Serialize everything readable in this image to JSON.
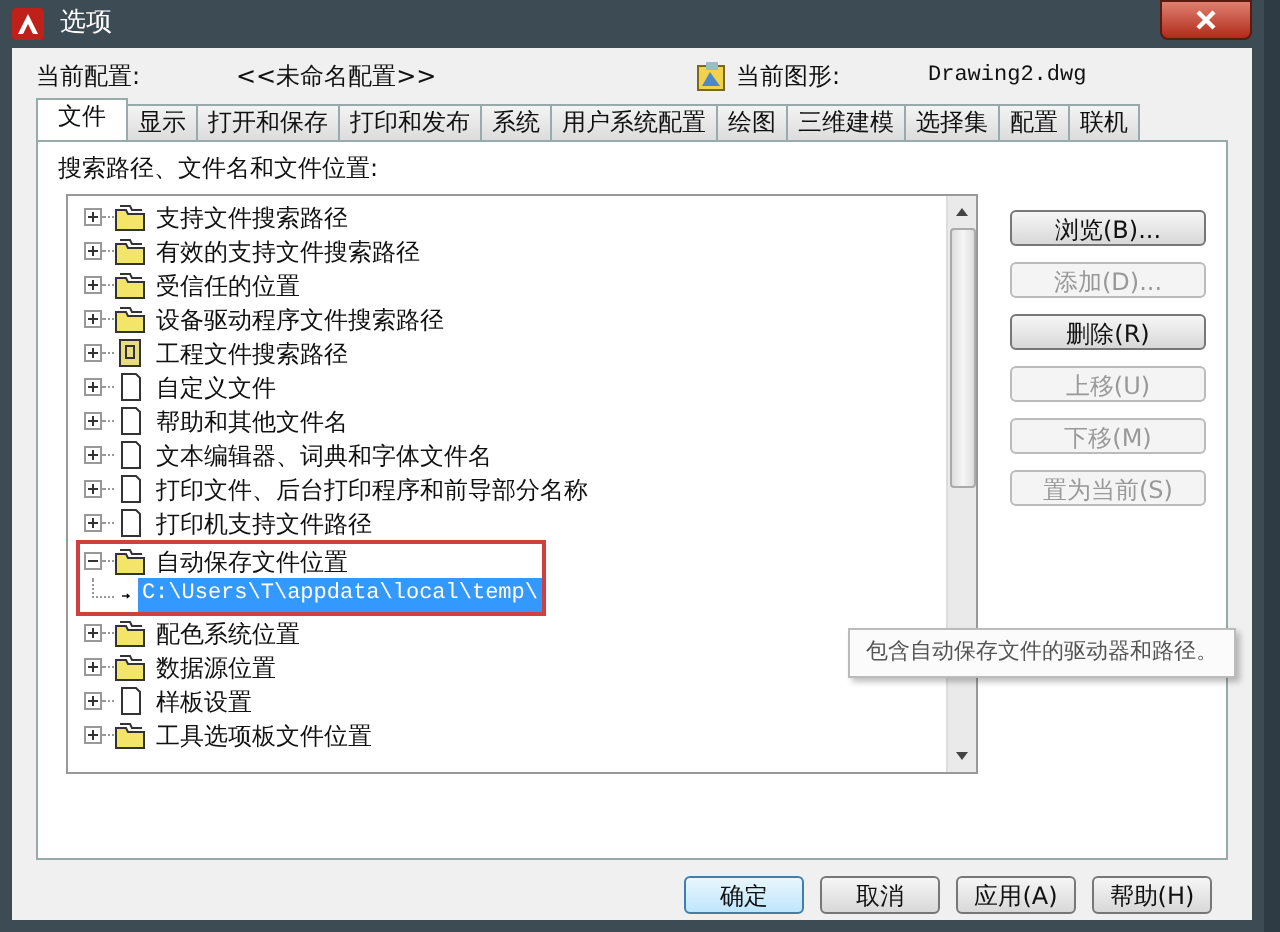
{
  "window": {
    "title": "选项"
  },
  "header": {
    "profile_label": "当前配置:",
    "profile": "<<未命名配置>>",
    "drawing_label": "当前图形:",
    "drawing": "Drawing2.dwg"
  },
  "tabs": [
    {
      "label": "文件",
      "selected": true
    },
    {
      "label": "显示",
      "selected": false
    },
    {
      "label": "打开和保存",
      "selected": false
    },
    {
      "label": "打印和发布",
      "selected": false
    },
    {
      "label": "系统",
      "selected": false
    },
    {
      "label": "用户系统配置",
      "selected": false
    },
    {
      "label": "绘图",
      "selected": false
    },
    {
      "label": "三维建模",
      "selected": false
    },
    {
      "label": "选择集",
      "selected": false
    },
    {
      "label": "配置",
      "selected": false
    },
    {
      "label": "联机",
      "selected": false
    }
  ],
  "panel": {
    "label": "搜索路径、文件名和文件位置:"
  },
  "tree": [
    {
      "label": "支持文件搜索路径",
      "kind": "folder",
      "expanded": false,
      "selected": false,
      "outlined": false
    },
    {
      "label": "有效的支持文件搜索路径",
      "kind": "folder",
      "expanded": false,
      "selected": false,
      "outlined": false
    },
    {
      "label": "受信任的位置",
      "kind": "folder",
      "expanded": false,
      "selected": false,
      "outlined": false
    },
    {
      "label": "设备驱动程序文件搜索路径",
      "kind": "folder",
      "expanded": false,
      "selected": false,
      "outlined": false
    },
    {
      "label": "工程文件搜索路径",
      "kind": "book",
      "expanded": false,
      "selected": false,
      "outlined": false
    },
    {
      "label": "自定义文件",
      "kind": "file",
      "expanded": false,
      "selected": false,
      "outlined": false
    },
    {
      "label": "帮助和其他文件名",
      "kind": "file",
      "expanded": false,
      "selected": false,
      "outlined": false
    },
    {
      "label": "文本编辑器、词典和字体文件名",
      "kind": "file",
      "expanded": false,
      "selected": false,
      "outlined": false
    },
    {
      "label": "打印文件、后台打印程序和前导部分名称",
      "kind": "file",
      "expanded": false,
      "selected": false,
      "outlined": false
    },
    {
      "label": "打印机支持文件路径",
      "kind": "file",
      "expanded": false,
      "selected": false,
      "outlined": false
    },
    {
      "label": "自动保存文件位置",
      "kind": "folder",
      "expanded": true,
      "selected": false,
      "outlined": true,
      "children": [
        {
          "label": "C:\\Users\\T\\appdata\\local\\temp\\",
          "selected": true
        }
      ]
    },
    {
      "label": "配色系统位置",
      "kind": "folder",
      "expanded": false,
      "selected": false,
      "outlined": false
    },
    {
      "label": "数据源位置",
      "kind": "folder",
      "expanded": false,
      "selected": false,
      "outlined": false
    },
    {
      "label": "样板设置",
      "kind": "file",
      "expanded": false,
      "selected": false,
      "outlined": false
    },
    {
      "label": "工具选项板文件位置",
      "kind": "folder",
      "expanded": false,
      "selected": false,
      "outlined": false
    }
  ],
  "side_buttons": [
    {
      "label": "浏览(B)...",
      "disabled": false
    },
    {
      "label": "添加(D)...",
      "disabled": true
    },
    {
      "label": "删除(R)",
      "disabled": false
    },
    {
      "label": "上移(U)",
      "disabled": true
    },
    {
      "label": "下移(M)",
      "disabled": true
    },
    {
      "label": "置为当前(S)",
      "disabled": true
    }
  ],
  "tooltip": "包含自动保存文件的驱动器和路径。",
  "footer_buttons": [
    {
      "label": "确定",
      "default": true,
      "disabled": false
    },
    {
      "label": "取消",
      "default": false,
      "disabled": false
    },
    {
      "label": "应用(A)",
      "default": false,
      "disabled": false
    },
    {
      "label": "帮助(H)",
      "default": false,
      "disabled": false
    }
  ]
}
